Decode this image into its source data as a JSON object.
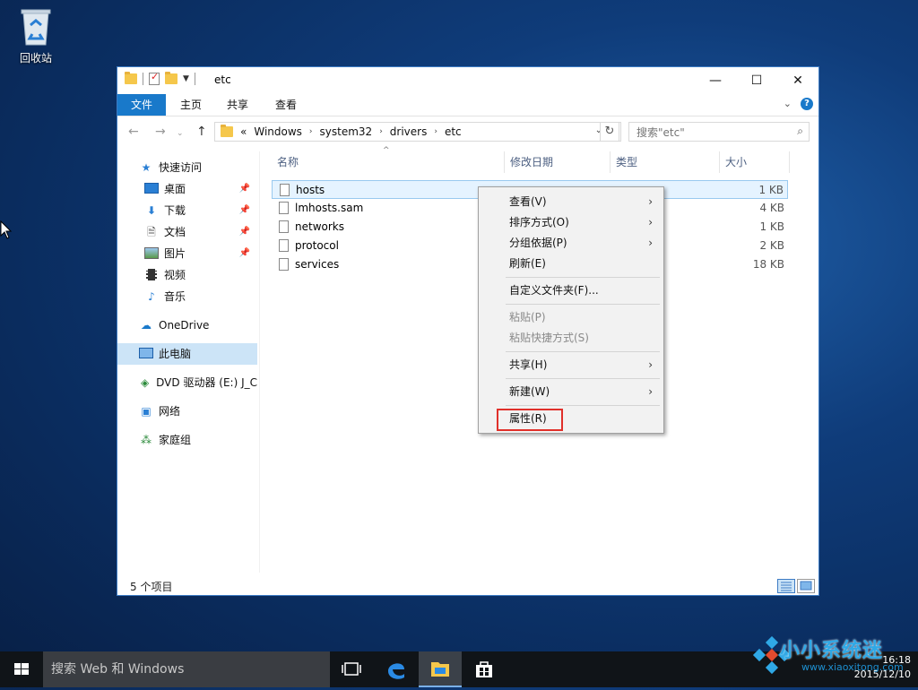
{
  "desktop": {
    "recycle_bin_label": "回收站"
  },
  "window": {
    "title": "etc",
    "controls": {
      "minimize": "—",
      "maximize": "☐",
      "close": "✕"
    },
    "ribbon_tabs": [
      "文件",
      "主页",
      "共享",
      "查看"
    ],
    "help": "?",
    "address": {
      "prefix": "«",
      "crumbs": [
        "Windows",
        "system32",
        "drivers",
        "etc"
      ]
    },
    "search_placeholder": "搜索\"etc\"",
    "nav_pane": {
      "quick_access": "快速访问",
      "quick_items": [
        "桌面",
        "下载",
        "文档",
        "图片",
        "视频",
        "音乐"
      ],
      "onedrive": "OneDrive",
      "this_pc": "此电脑",
      "dvd": "DVD 驱动器 (E:) J_C",
      "network": "网络",
      "homegroup": "家庭组"
    },
    "columns": {
      "name": "名称",
      "modified": "修改日期",
      "type": "类型",
      "size": "大小"
    },
    "files": [
      {
        "name": "hosts",
        "size": "1 KB"
      },
      {
        "name": "lmhosts.sam",
        "size": "4 KB"
      },
      {
        "name": "networks",
        "size": "1 KB"
      },
      {
        "name": "protocol",
        "size": "2 KB"
      },
      {
        "name": "services",
        "size": "18 KB"
      }
    ],
    "status": "5 个项目"
  },
  "context_menu": {
    "items": [
      {
        "label": "查看(V)",
        "submenu": true
      },
      {
        "label": "排序方式(O)",
        "submenu": true
      },
      {
        "label": "分组依据(P)",
        "submenu": true
      },
      {
        "label": "刷新(E)"
      },
      {
        "label": "自定义文件夹(F)..."
      },
      {
        "label": "粘贴(P)",
        "disabled": true
      },
      {
        "label": "粘贴快捷方式(S)",
        "disabled": true
      },
      {
        "label": "共享(H)",
        "submenu": true
      },
      {
        "label": "新建(W)",
        "submenu": true
      },
      {
        "label": "属性(R)",
        "highlighted": true
      }
    ],
    "highlight_color": "#e0302a"
  },
  "taskbar": {
    "search_text": "搜索 Web 和 Windows",
    "clock_time": "16:18",
    "clock_date": "2015/12/10"
  },
  "watermark": {
    "text": "小小系统迷",
    "url": "www.xiaoxitong.com"
  },
  "colors": {
    "accent": "#1979ca",
    "selection": "#cce4f7",
    "desktop": "#0f3c7a"
  }
}
